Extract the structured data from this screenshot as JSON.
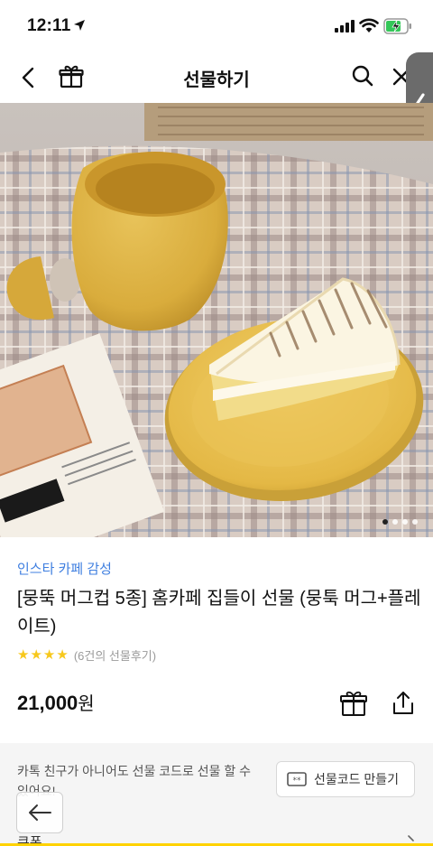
{
  "status": {
    "time": "12:11"
  },
  "nav": {
    "title": "선물하기"
  },
  "gallery": {
    "total_images": 4,
    "current_index": 1
  },
  "product": {
    "tagline": "인스타 카페 감성",
    "title": "[뭉뚝 머그컵 5종] 홈카페 집들이 선물 (뭉툭 머그+플레이트)",
    "rating_stars": 4,
    "review_count": "(6건의 선물후기)",
    "price": "21,000",
    "price_unit": "원"
  },
  "gift_code": {
    "description": "카톡 친구가 아니어도 선물 코드로 선물 할 수 있어요!",
    "button_label": "선물코드 만들기"
  },
  "cut_off_text": "쿠폰",
  "colors": {
    "tagline": "#3f7fe0",
    "star": "#f7c81c",
    "accent": "#ffd200"
  }
}
